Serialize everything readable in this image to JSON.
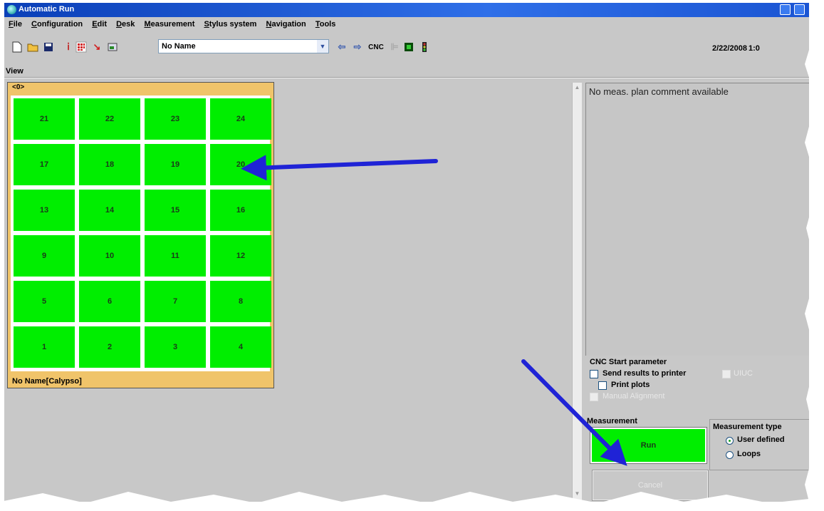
{
  "window": {
    "title": "Automatic Run"
  },
  "menu": [
    "File",
    "Configuration",
    "Edit",
    "Desk",
    "Measurement",
    "Stylus system",
    "Navigation",
    "Tools"
  ],
  "toolbar": {
    "plan_name": "No Name",
    "cnc_label": "CNC",
    "date": "2/22/2008",
    "time": "1:0"
  },
  "view": {
    "label": "View"
  },
  "pallet": {
    "header": "<0>",
    "footer": "No Name[Calypso]",
    "rows": [
      [
        "21",
        "22",
        "23",
        "24"
      ],
      [
        "17",
        "18",
        "19",
        "20"
      ],
      [
        "13",
        "14",
        "15",
        "16"
      ],
      [
        "9",
        "10",
        "11",
        "12"
      ],
      [
        "5",
        "6",
        "7",
        "8"
      ],
      [
        "1",
        "2",
        "3",
        "4"
      ]
    ],
    "cell_color": "#00ee00"
  },
  "comment": {
    "text": "No meas. plan comment available"
  },
  "cnc_start": {
    "header": "CNC Start parameter",
    "send_results": "Send results to printer",
    "disabled_option": "UIUC",
    "print_plots": "Print plots",
    "manual_alignment": "Manual Alignment"
  },
  "measurement": {
    "header": "Measurement",
    "run_label": "Run",
    "cancel_label": "Cancel"
  },
  "measurement_type": {
    "header": "Measurement type",
    "options": [
      "User defined",
      "Loops"
    ],
    "selected": "User defined"
  },
  "annotation_color": "#1f23d6"
}
